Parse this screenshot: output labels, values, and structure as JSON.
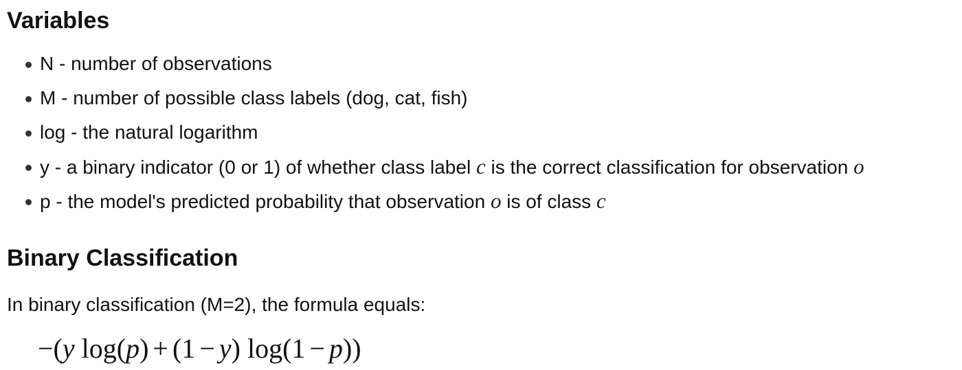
{
  "sections": {
    "variables_heading": "Variables",
    "binary_heading": "Binary Classification"
  },
  "variables": [
    {
      "text": "N - number of observations"
    },
    {
      "text": "M - number of possible class labels (dog, cat, fish)"
    },
    {
      "text": "log - the natural logarithm"
    },
    {
      "text_a": "y - a binary indicator (0 or 1) of whether class label ",
      "var_a": "c",
      "text_b": " is the correct classification for observation ",
      "var_b": "o"
    },
    {
      "text_a": "p - the model's predicted probability that observation ",
      "var_a": "o",
      "text_b": " is of class ",
      "var_b": "c"
    }
  ],
  "binary": {
    "intro": "In binary classification (M=2), the formula equals:",
    "formula": {
      "neg_open": "−(",
      "y1": "y",
      "log1": " log(",
      "p1": "p",
      "close1": ")",
      "plus": "+",
      "open2": "(1",
      "minus1": "−",
      "y2": "y",
      "log2": ") log(1",
      "minus2": "−",
      "p2": "p",
      "close_all": "))"
    }
  }
}
